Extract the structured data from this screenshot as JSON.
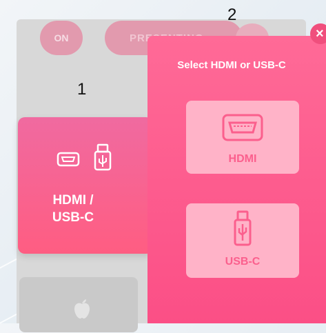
{
  "steps": {
    "step1": "1",
    "step2": "2"
  },
  "background_app": {
    "on_toggle": "ON",
    "mode_pill": "PRESENTING"
  },
  "source_tile": {
    "label": "HDMI /\nUSB-C",
    "icons": [
      "hdmi-port-icon",
      "usb-drive-icon"
    ]
  },
  "popup": {
    "title": "Select HDMI or USB-C",
    "close_glyph": "×",
    "options": [
      {
        "label": "HDMI",
        "icon": "hdmi-port-icon"
      },
      {
        "label": "USB-C",
        "icon": "usb-drive-icon"
      }
    ]
  },
  "colors": {
    "accent": "#fb5f8d",
    "option_bg": "#ffb3c8",
    "dim_panel": "#d8d8d8"
  }
}
